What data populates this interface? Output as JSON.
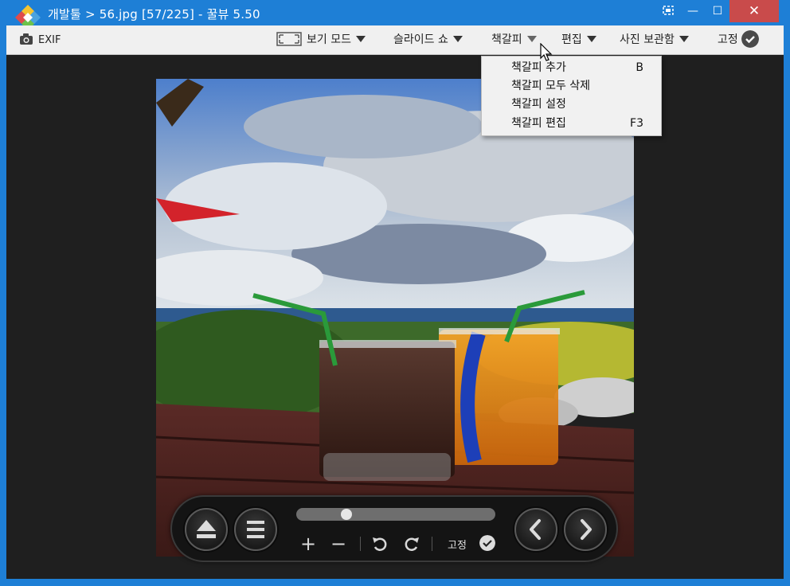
{
  "window": {
    "title": "개발툴 > 56.jpg [57/225] - 꿀뷰 5.50",
    "close_symbol": "✕",
    "minimize_symbol": "—",
    "maximize_symbol": "☐"
  },
  "menubar": {
    "exif_label": "EXIF",
    "view_mode_label": "보기 모드",
    "slideshow_label": "슬라이드 쇼",
    "bookmark_label": "책갈피",
    "edit_label": "편집",
    "photo_storage_label": "사진 보관함",
    "pin_label": "고정"
  },
  "bookmark_menu": {
    "items": [
      {
        "label": "책갈피 추가",
        "shortcut": "B"
      },
      {
        "label": "책갈피 모두 삭제",
        "shortcut": ""
      },
      {
        "label": "책갈피 설정",
        "shortcut": ""
      },
      {
        "label": "책갈피 편집",
        "shortcut": "F3"
      }
    ]
  },
  "controls": {
    "zoom_in": "+",
    "zoom_out": "−",
    "pin_label": "고정"
  },
  "icons": [
    "app-logo-icon",
    "camera-icon",
    "fit-screen-icon",
    "check-circle-icon",
    "eject-icon",
    "list-icon",
    "rotate-left-icon",
    "rotate-right-icon",
    "prev-icon",
    "next-icon",
    "mouse-cursor-icon"
  ],
  "colors": {
    "titlebar": "#1e7fd6",
    "close_button": "#c94b4b",
    "menubar": "#f0f0f0",
    "viewer_bg": "#1f1f1f"
  }
}
